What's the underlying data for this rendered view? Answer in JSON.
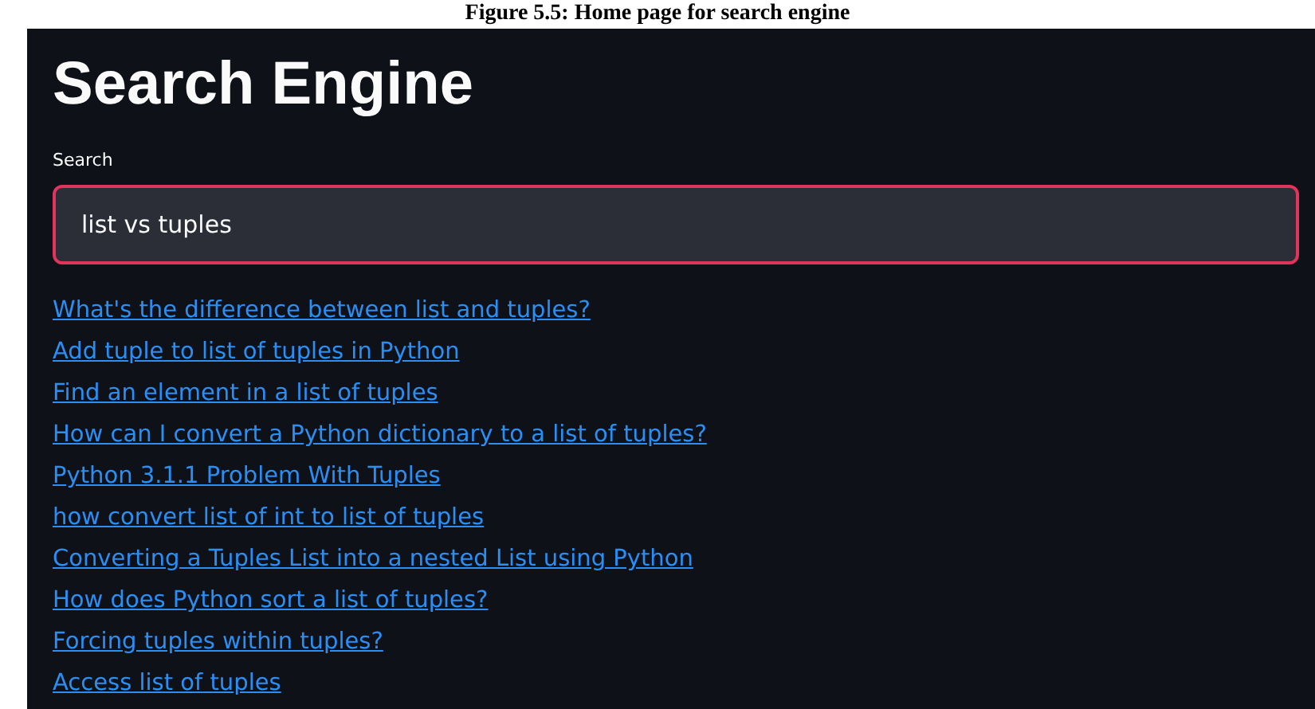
{
  "caption": "Figure 5.5: Home page for search engine",
  "title": "Search Engine",
  "search": {
    "label": "Search",
    "value": "list vs tuples",
    "focused": true
  },
  "results": [
    {
      "text": "What's the difference between list and tuples?"
    },
    {
      "text": "Add tuple to list of tuples in Python"
    },
    {
      "text": "Find an element in a list of tuples"
    },
    {
      "text": "How can I convert a Python dictionary to a list of tuples?"
    },
    {
      "text": "Python 3.1.1 Problem With Tuples"
    },
    {
      "text": "how convert list of int to list of tuples"
    },
    {
      "text": "Converting a Tuples List into a nested List using Python"
    },
    {
      "text": "How does Python sort a list of tuples?"
    },
    {
      "text": "Forcing tuples within tuples?"
    },
    {
      "text": "Access list of tuples"
    }
  ]
}
